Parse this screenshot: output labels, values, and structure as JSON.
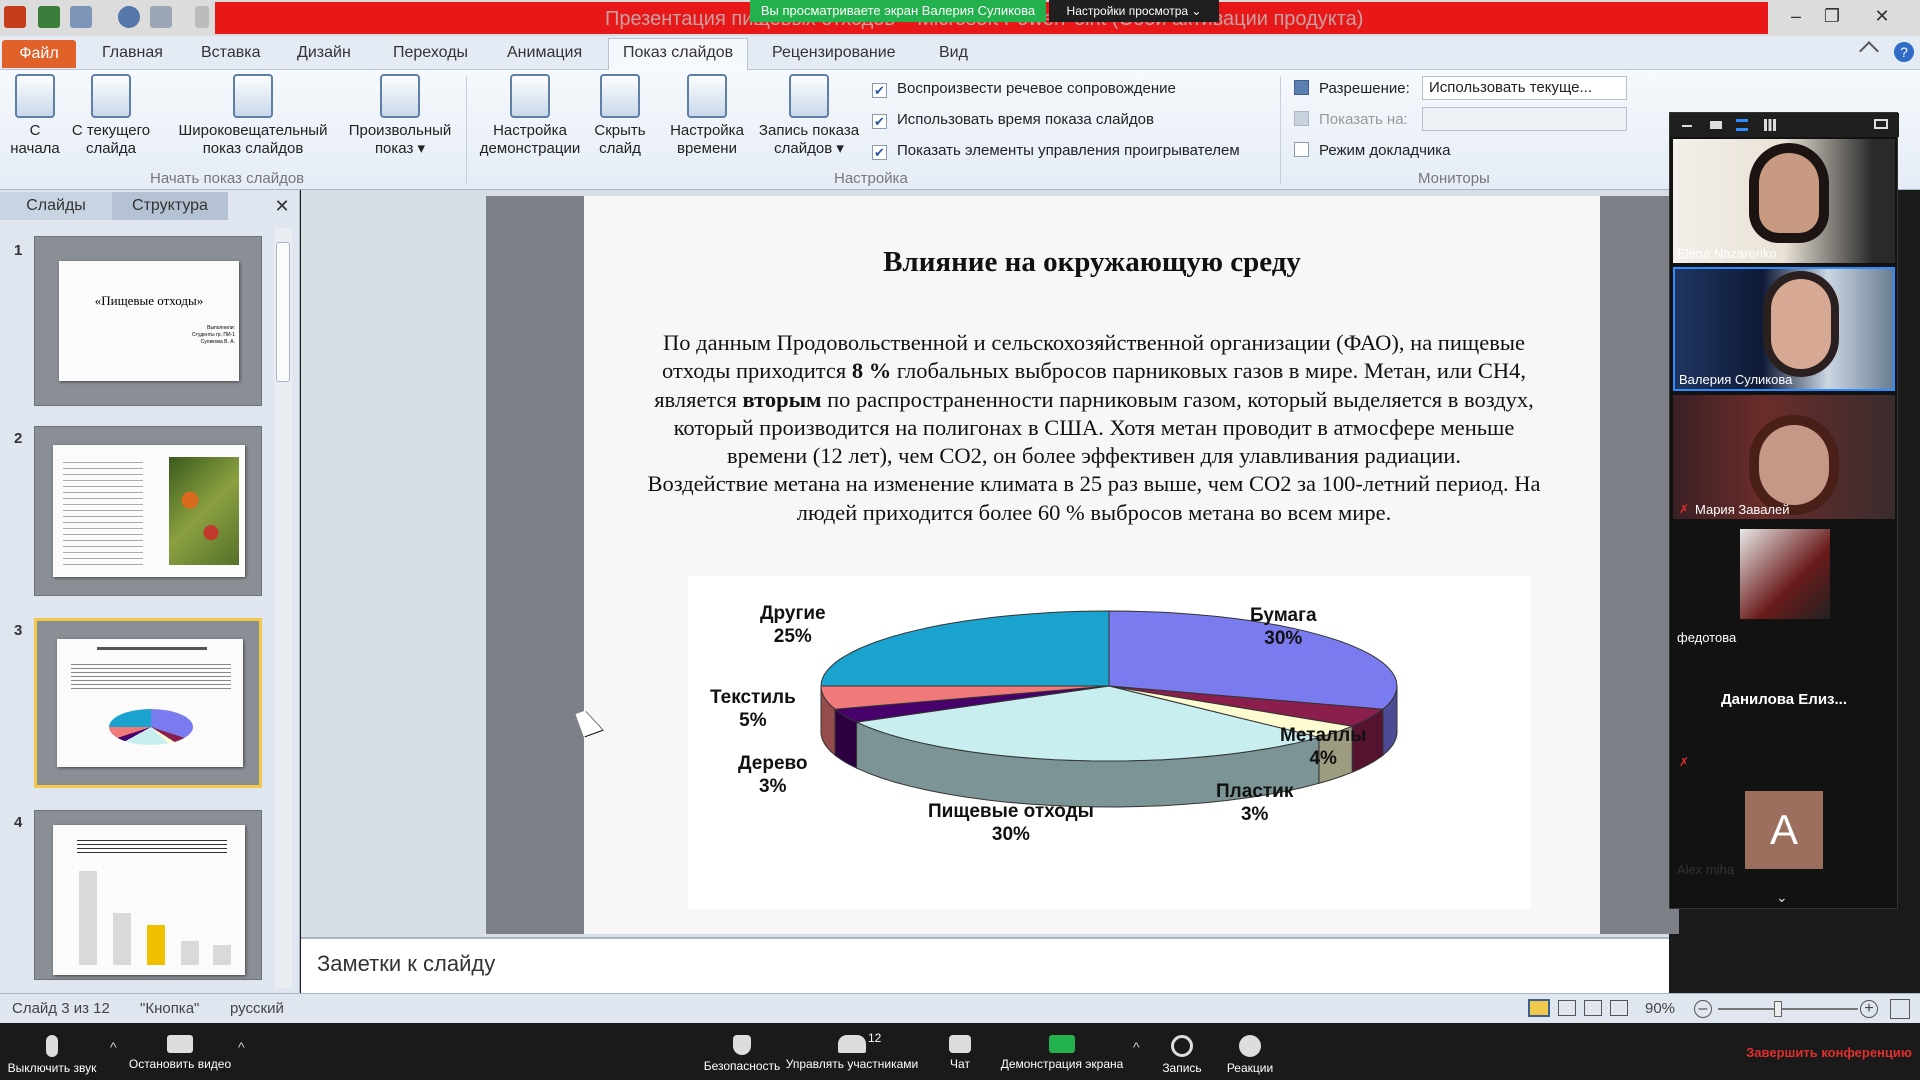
{
  "window": {
    "title": "Презентация пищевых отходов – Microsoft PowerPoint (Сбой активации продукта)",
    "minimize": "–",
    "maximize": "❐",
    "close": "✕"
  },
  "zoom": {
    "banner": "Вы просматриваете экран Валерия Суликова",
    "view_settings": "Настройки просмотра ⌄"
  },
  "tabs": {
    "file": "Файл",
    "items": [
      "Главная",
      "Вставка",
      "Дизайн",
      "Переходы",
      "Анимация",
      "Показ слайдов",
      "Рецензирование",
      "Вид"
    ]
  },
  "ribbon": {
    "from_start": "С\nначала",
    "from_current": "С текущего\nслайда",
    "broadcast": "Широковещательный\nпоказ слайдов",
    "custom": "Произвольный\nпоказ ▾",
    "group_start": "Начать показ слайдов",
    "setup": "Настройка\nдемонстрации",
    "hide": "Скрыть\nслайд",
    "timing": "Настройка\nвремени",
    "record": "Запись показа\nслайдов ▾",
    "chk1": "Воспроизвести речевое сопровождение",
    "chk2": "Использовать время показа слайдов",
    "chk3": "Показать элементы управления проигрывателем",
    "group_setup": "Настройка",
    "resolution_label": "Разрешение:",
    "resolution_value": "Использовать текуще...",
    "show_on_label": "Показать на:",
    "presenter": "Режим докладчика",
    "group_monitors": "Мониторы"
  },
  "pane": {
    "tab_slides": "Слайды",
    "tab_outline": "Структура",
    "close": "✕",
    "thumb1_title": "«Пищевые отходы»",
    "thumb1_sub": "Выполнили:\nСтуденты гр. ПИ-1\nСуликова В. А.",
    "nums": [
      "1",
      "2",
      "3",
      "4"
    ]
  },
  "slide": {
    "title": "Влияние на окружающую среду",
    "p1a": "По данным Продовольственной и сельскохозяйственной организации (ФАО), на пищевые отходы приходится ",
    "p1b": "8 %",
    "p1c": " глобальных выбросов парниковых газов в мире. Метан, или CH4, является ",
    "p1d": "вторым",
    "p1e": " по распространенности парниковым газом, который выделяется в воздух, который производится на полигонах в США. Хотя метан проводит в атмосфере меньше времени (12 лет), чем CO2, он более эффективен для улавливания радиации.",
    "p2": "Воздействие метана на изменение климата в 25 раз выше, чем CO2 за 100-летний период. На людей приходится более 60 % выбросов метана во всем мире."
  },
  "chart_data": {
    "type": "pie",
    "categories": [
      "Бумага",
      "Металлы",
      "Пластик",
      "Пищевые отходы",
      "Дерево",
      "Текстиль",
      "Другие"
    ],
    "values": [
      30,
      4,
      3,
      30,
      3,
      5,
      25
    ],
    "labels": [
      "Бумага\n30%",
      "Металлы\n4%",
      "Пластик\n3%",
      "Пищевые отходы\n30%",
      "Дерево\n3%",
      "Текстиль\n5%",
      "Другие\n25%"
    ],
    "colors": [
      "#7b7bf0",
      "#8a1f4e",
      "#fdfbd0",
      "#c8eef0",
      "#48006b",
      "#f07a7a",
      "#1aa3cf"
    ]
  },
  "notes": {
    "label": "Заметки к слайду"
  },
  "status": {
    "slide": "Слайд 3 из 12",
    "theme": "\"Кнопка\"",
    "lang": "русский",
    "zoom": "90%"
  },
  "participants": [
    {
      "name": "Elena Nazarenko"
    },
    {
      "name": "Валерия Суликова"
    },
    {
      "name": "Мария Завалей"
    },
    {
      "name": "федотова"
    },
    {
      "name": "Данилова  Елиз..."
    },
    {
      "name": "Alex miha",
      "initial": "A"
    }
  ],
  "zoombar": {
    "mute": "Выключить звук",
    "video": "Остановить видео",
    "security": "Безопасность",
    "participants": "Управлять участниками",
    "participants_count": "12",
    "chat": "Чат",
    "share": "Демонстрация экрана",
    "record": "Запись",
    "reactions": "Реакции",
    "end": "Завершить конференцию"
  }
}
